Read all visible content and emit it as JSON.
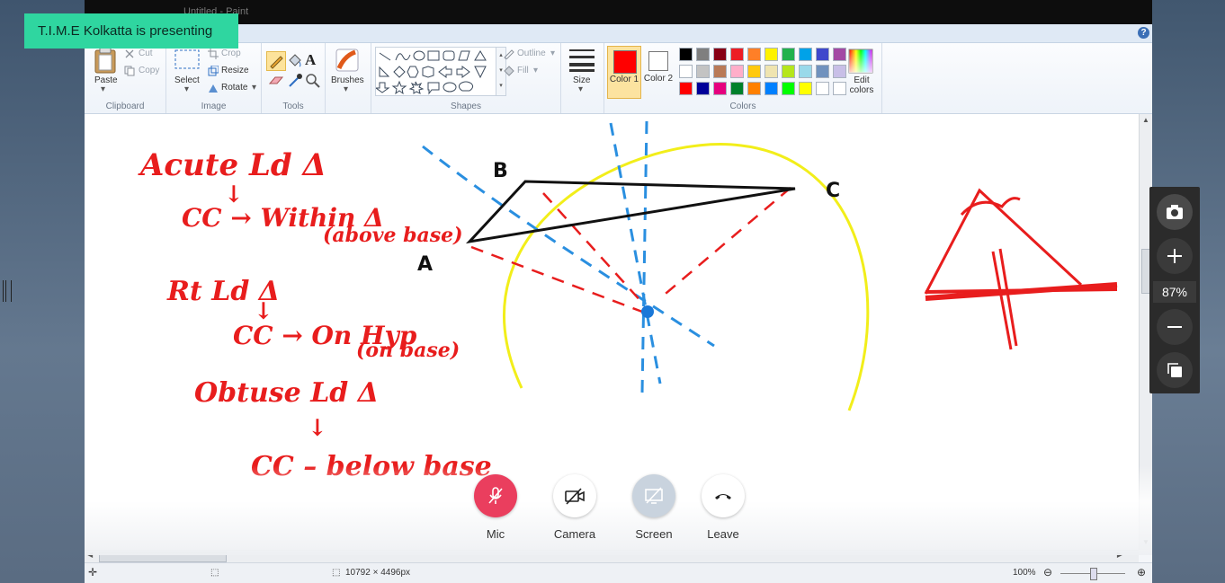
{
  "presenter_banner": "T.I.M.E Kolkatta is presenting",
  "app": {
    "title": "Untitled - Paint",
    "help": "?"
  },
  "ribbon": {
    "clipboard": {
      "paste": "Paste",
      "cut": "Cut",
      "copy": "Copy",
      "label": "Clipboard"
    },
    "image": {
      "select": "Select",
      "crop": "Crop",
      "resize": "Resize",
      "rotate": "Rotate",
      "label": "Image"
    },
    "tools": {
      "label": "Tools"
    },
    "brushes": {
      "label": "Brushes"
    },
    "shapes": {
      "outline": "Outline",
      "fill": "Fill",
      "label": "Shapes"
    },
    "size": {
      "label": "Size"
    },
    "colors": {
      "color1": "Color 1",
      "color2": "Color 2",
      "edit": "Edit colors",
      "label": "Colors",
      "color1_value": "#ff0000",
      "color2_value": "#ffffff",
      "palette_row1": [
        "#000000",
        "#7f7f7f",
        "#880015",
        "#ed1c24",
        "#ff7f27",
        "#fff200",
        "#22b14c",
        "#00a2e8",
        "#3f48cc",
        "#a349a4"
      ],
      "palette_row2": [
        "#ffffff",
        "#c3c3c3",
        "#b97a57",
        "#ffaec9",
        "#ffc90e",
        "#efe4b0",
        "#b5e61d",
        "#99d9ea",
        "#7092be",
        "#c8bfe7"
      ],
      "palette_row3": [
        "#ff0000",
        "#000099",
        "#e6007e",
        "#00802b",
        "#ff8000",
        "#0080ff",
        "#00ff00",
        "#ffff00",
        "#ffffff",
        "#ffffff"
      ]
    }
  },
  "canvas_text": {
    "line1": "Acute Ld Δ",
    "line2": "CC → Within Δ",
    "line3": "(above base)",
    "line4": "Rt Ld Δ",
    "line5": "CC → On Hyp",
    "line6": "(on base)",
    "line7": "Obtuse Ld Δ",
    "line8": "CC – below base",
    "pt_a": "A",
    "pt_b": "B",
    "pt_c": "C"
  },
  "status": {
    "dimensions": "10792 × 4496px",
    "zoom": "100%"
  },
  "call": {
    "mic": "Mic",
    "camera": "Camera",
    "screen": "Screen",
    "leave": "Leave"
  },
  "viewer": {
    "zoom": "87%"
  }
}
